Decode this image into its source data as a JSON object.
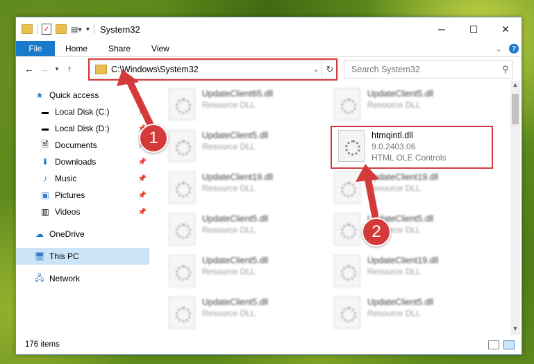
{
  "window": {
    "title": "System32"
  },
  "ribbon": {
    "file": "File",
    "tabs": [
      "Home",
      "Share",
      "View"
    ]
  },
  "address": {
    "path": "C:\\Windows\\System32"
  },
  "search": {
    "placeholder": "Search System32"
  },
  "sidebar": {
    "items": [
      {
        "label": "Quick access",
        "icon": "star-icon"
      },
      {
        "label": "Local Disk (C:)",
        "icon": "drive-icon"
      },
      {
        "label": "Local Disk (D:)",
        "icon": "drive-icon"
      },
      {
        "label": "Documents",
        "icon": "documents-icon"
      },
      {
        "label": "Downloads",
        "icon": "download-icon"
      },
      {
        "label": "Music",
        "icon": "music-icon"
      },
      {
        "label": "Pictures",
        "icon": "pictures-icon"
      },
      {
        "label": "Videos",
        "icon": "videos-icon"
      },
      {
        "label": "OneDrive",
        "icon": "cloud-icon"
      },
      {
        "label": "This PC",
        "icon": "computer-icon"
      },
      {
        "label": "Network",
        "icon": "network-icon"
      }
    ],
    "selected": "This PC"
  },
  "files": {
    "left": [
      {
        "name": "UpdateClient65.dll",
        "meta": "Resource DLL"
      },
      {
        "name": "UpdateClient5.dll",
        "meta": "Resource DLL"
      },
      {
        "name": "UpdateClient19.dll",
        "meta": "Resource DLL"
      },
      {
        "name": "UpdateClient5.dll",
        "meta": "Resource DLL"
      },
      {
        "name": "UpdateClient5.dll",
        "meta": "Resource DLL"
      },
      {
        "name": "UpdateClient5.dll",
        "meta": "Resource DLL"
      }
    ],
    "right": [
      {
        "name": "UpdateClient5.dll",
        "meta": "Resource DLL"
      },
      {
        "name": "htmqintl.dll",
        "meta": "9.0.2403.06",
        "meta2": "HTML OLE Controls"
      },
      {
        "name": "UpdateClient19.dll",
        "meta": "Resource DLL"
      },
      {
        "name": "UpdateClient5.dll",
        "meta": "Resource DLL"
      },
      {
        "name": "UpdateClient19.dll",
        "meta": "Resource DLL"
      },
      {
        "name": "UpdateClient5.dll",
        "meta": "Resource DLL"
      }
    ]
  },
  "status": {
    "count": "176 items"
  },
  "callouts": [
    "1",
    "2"
  ],
  "colors": {
    "accent": "#1979ca",
    "highlight": "#d23c3c"
  }
}
